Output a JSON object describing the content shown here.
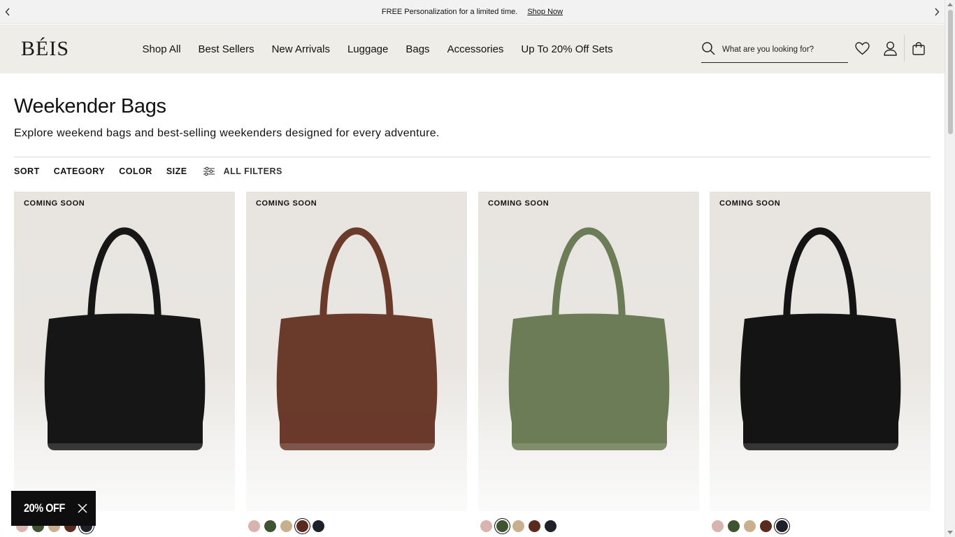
{
  "announcement": {
    "message": "FREE Personalization for a limited time.",
    "link": "Shop Now"
  },
  "header": {
    "logo": "BÉIS",
    "nav": [
      "Shop All",
      "Best Sellers",
      "New Arrivals",
      "Luggage",
      "Bags",
      "Accessories",
      "Up To 20% Off Sets"
    ],
    "search_placeholder": "What are you looking for?",
    "icons": [
      "search-icon",
      "heart-icon",
      "account-icon",
      "cart-icon"
    ]
  },
  "page": {
    "title": "Weekender Bags",
    "description": "Explore weekend bags and best-selling weekenders designed for every adventure."
  },
  "filters": {
    "sort": "SORT",
    "category": "CATEGORY",
    "color": "COLOR",
    "size": "SIZE",
    "all": "ALL FILTERS"
  },
  "products": [
    {
      "badge": "COMING SOON",
      "bag_color": "#161616",
      "selected_swatch": 4
    },
    {
      "badge": "COMING SOON",
      "bag_color": "#6a3a2b",
      "selected_swatch": 3
    },
    {
      "badge": "COMING SOON",
      "bag_color": "#6b7c57",
      "selected_swatch": 1
    },
    {
      "badge": "COMING SOON",
      "bag_color": "#141414",
      "selected_swatch": 4
    }
  ],
  "swatch_colors": [
    "#d9b3ae",
    "#3f5331",
    "#c8b08f",
    "#5a2a1f",
    "#1e2128"
  ],
  "promo": {
    "label": "20% OFF"
  }
}
